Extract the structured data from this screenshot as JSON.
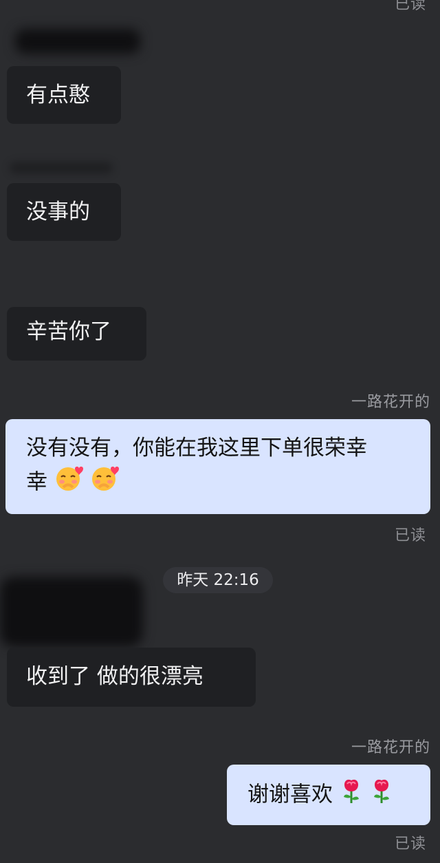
{
  "status": {
    "read_label": "已读"
  },
  "messages": {
    "m1": "有点憨",
    "m2": "没事的",
    "m3": "辛苦你了",
    "m4_sender": "一路花开的",
    "m4_text": "没有没有，你能在我这里下单很荣幸",
    "m5_time": "昨天 22:16",
    "m5_text": "收到了 做的很漂亮",
    "m6_sender": "一路花开的",
    "m6_text": "谢谢喜欢"
  },
  "colors": {
    "background": "#2b2c2f",
    "incoming_bubble": "#1f2023",
    "outgoing_bubble": "#d9e4ff",
    "muted_text": "#8f9095"
  },
  "icons": {
    "blush_hug_emoji": "blush-hug-emoji",
    "rose_emoji": "rose-emoji"
  }
}
